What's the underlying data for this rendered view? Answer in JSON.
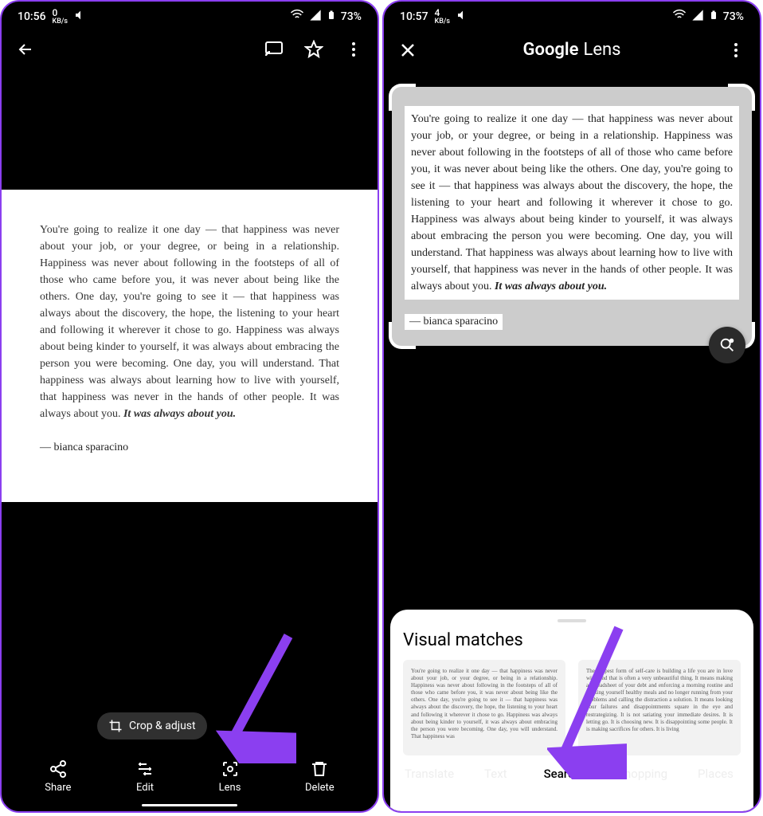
{
  "status": {
    "time_left": "10:56",
    "time_right": "10:57",
    "kbs_left_num": "0",
    "kbs_right_num": "4",
    "kbs_unit": "KB/s",
    "battery": "73%"
  },
  "quote": {
    "body": "You're going to realize it one day — that happiness was never about your job, or your degree, or being in a relationship. Happiness was never about following in the footsteps of all of those who came before you, it was never about being like the others. One day, you're going to see it — that happiness was always about the discovery, the hope, the listening to your heart and following it wherever it chose to go. Happiness was always about being kinder to yourself, it was always about embracing the person you were becoming. One day, you will understand. That happiness was always about learning how to live with yourself, that happiness was never in the hands of other people. It was always about you. ",
    "bold": "It was always about you.",
    "author": "— bianca sparacino"
  },
  "photos": {
    "crop_label": "Crop & adjust",
    "actions": {
      "share": "Share",
      "edit": "Edit",
      "lens": "Lens",
      "delete": "Delete"
    }
  },
  "lens": {
    "title_google": "Google",
    "title_lens": "Lens",
    "sheet_title": "Visual matches",
    "tabs": {
      "translate": "Translate",
      "text": "Text",
      "search": "Search",
      "shopping": "Shopping",
      "places": "Places"
    },
    "match1": "You're going to realize it one day — that happiness was never about your job, or your degree, or being in a relationship. Happiness was never about following in the footsteps of all of those who came before you, it was never about being like the others. One day, you're going to see it — that happiness was always about the discovery, the hope, the listening to your heart and following it wherever it chose to go. Happiness was always about being kinder to yourself, it was always about embracing the person you were becoming. One day, you will understand. That happiness was",
    "match2": "The deepest form of self-care is building a life you are in love with, and that is often a very unbeautiful thing. It means making a spreadsheet of your debt and enforcing a morning routine and cooking yourself healthy meals and no longer running from your problems and calling the distraction a solution. It means looking your failures and disappointments square in the eye and restrategizing. It is not satiating your immediate desires. It is letting go. It is choosing new. It is disappointing some people. It is making sacrifices for others. It is living"
  }
}
